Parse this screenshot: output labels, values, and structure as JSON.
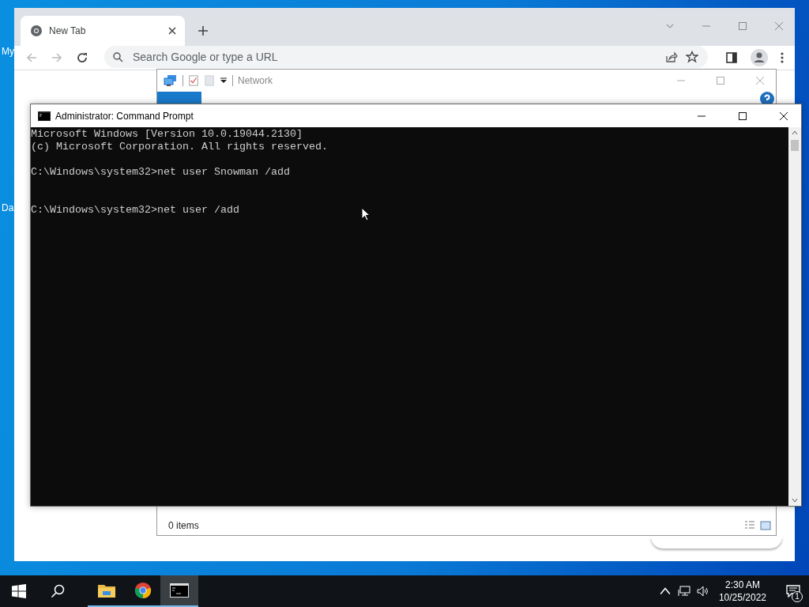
{
  "desktop": {
    "icon_labels": [
      "My",
      "Da"
    ]
  },
  "chrome": {
    "tabs": [
      {
        "label": "New Tab",
        "selected": true
      }
    ],
    "omnibox": {
      "placeholder": "Search Google or type a URL"
    }
  },
  "explorer": {
    "title": "Network",
    "status": "0 items"
  },
  "cmd": {
    "title": "Administrator: Command Prompt",
    "blocks": [
      {
        "lines": [
          "Microsoft Windows [Version 10.0.19044.2130]",
          "(c) Microsoft Corporation. All rights reserved."
        ],
        "empty_output": false
      },
      {
        "lines": [
          "C:\\Windows\\system32>net user Snowman /add"
        ],
        "empty_output": true
      },
      {
        "lines": [
          "C:\\Windows\\system32>net user /add"
        ],
        "empty_output": false
      }
    ]
  },
  "taskbar": {
    "apps": [
      {
        "kind": "explorer",
        "running": true,
        "selected": false
      },
      {
        "kind": "chrome",
        "running": true,
        "selected": false
      },
      {
        "kind": "cmd",
        "running": true,
        "selected": true
      }
    ],
    "time": "2:30 AM",
    "date": "10/25/2022",
    "notification_count": "1"
  }
}
